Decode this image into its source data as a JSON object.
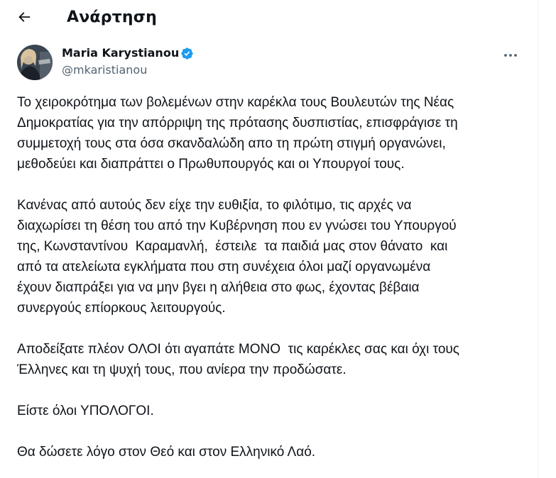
{
  "header": {
    "title": "Ανάρτηση",
    "back_icon": "arrow-left-icon"
  },
  "author": {
    "name": "Maria Karystianou",
    "handle": "@mkaristianou",
    "verified_color": "#1d9bf0",
    "avatar_icon": "profile-photo"
  },
  "more_icon": "more-horizontal-icon",
  "post": {
    "paragraphs": [
      {
        "lines": [
          "Το χειροκρότημα των βολεμένων στην καρέκλα τους Βουλευτών της Νέας",
          "Δημοκρατίας για την απόρριψη της πρότασης δυσπιστίας, επισφράγισε τη",
          "συμμετοχή τους στα όσα σκανδαλώδη απο τη πρώτη στιγμή οργανώνει,",
          "μεθοδεύει και διαπράττει ο Πρωθυπουργός και οι Υπουργοί τους."
        ]
      },
      {
        "lines": [
          "Κανένας από αυτούς δεν είχε την ευθιξία, το φιλότιμο, τις αρχές να",
          "διαχωρίσει τη θέση του από την Κυβέρνηση που εν γνώσει του Υπουργού",
          "της, Κωνσταντίνου  Καραμανλή,  έστειλε  τα παιδιά μας στον θάνατο  και",
          "από τα ατελείωτα εγκλήματα που στη συνέχεια όλοι μαζί οργανωμένα",
          "έχουν διαπράξει για να μην βγει η αλήθεια στο φως, έχοντας βέβαια",
          "συνεργούς επίορκους λειτουργούς."
        ]
      },
      {
        "lines": [
          "Αποδείξατε πλέον ΟΛΟΙ ότι αγαπάτε ΜΟΝΟ  τις καρέκλες σας και όχι τους",
          "Έλληνες και τη ψυχή τους, που ανίερα την προδώσατε."
        ]
      },
      {
        "lines": [
          "Είστε όλοι ΥΠΟΛΟΓΟΙ."
        ]
      },
      {
        "lines": [
          "Θα δώσετε λόγο στον Θεό και στον Ελληνικό Λαό."
        ]
      }
    ]
  }
}
